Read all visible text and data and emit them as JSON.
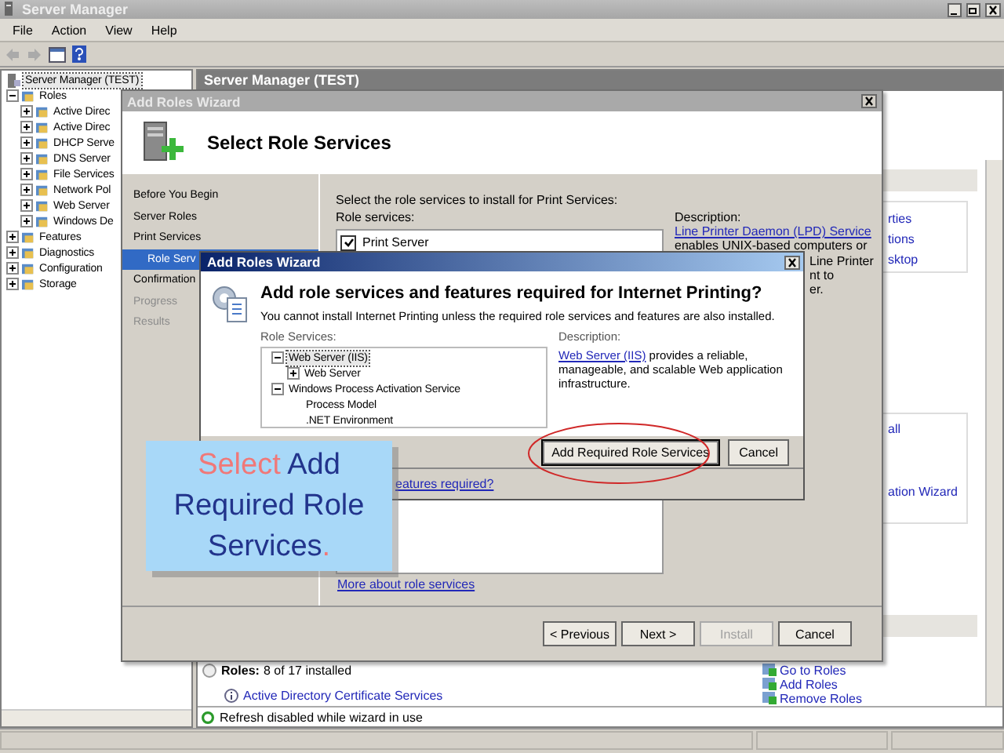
{
  "main_window": {
    "title": "Server Manager",
    "menu": [
      "File",
      "Action",
      "View",
      "Help"
    ]
  },
  "tree": {
    "root": {
      "label": "Server Manager (TEST)",
      "selected": true
    },
    "items": [
      {
        "label": "Roles",
        "expanded": true,
        "children": [
          {
            "label": "Active Direc",
            "expanded": false
          },
          {
            "label": "Active Direc",
            "expanded": false
          },
          {
            "label": "DHCP Serve",
            "expanded": false
          },
          {
            "label": "DNS Server",
            "expanded": false
          },
          {
            "label": "File Services",
            "expanded": false
          },
          {
            "label": "Network Pol",
            "expanded": false
          },
          {
            "label": "Web Server",
            "expanded": false
          },
          {
            "label": "Windows De",
            "expanded": false
          }
        ]
      },
      {
        "label": "Features",
        "expanded": false
      },
      {
        "label": "Diagnostics",
        "expanded": false
      },
      {
        "label": "Configuration",
        "expanded": false
      },
      {
        "label": "Storage",
        "expanded": false
      }
    ]
  },
  "content": {
    "header": "Server Manager (TEST)",
    "side_links_top": [
      "rties",
      "tions",
      "sktop"
    ],
    "side_links_middle": [
      "all",
      "ation Wizard"
    ],
    "roles_label": "Roles:",
    "roles_count": "8 of 17 installed",
    "role_entry": "Active Directory Certificate Services",
    "tasks": [
      "Go to Roles",
      "Add Roles",
      "Remove Roles"
    ],
    "status": "Refresh disabled while wizard in use"
  },
  "wizard": {
    "title": "Add Roles Wizard",
    "heading": "Select Role Services",
    "steps": [
      {
        "label": "Before You Begin",
        "selected": false,
        "disabled": false
      },
      {
        "label": "Server Roles",
        "selected": false,
        "disabled": false
      },
      {
        "label": "Print Services",
        "selected": false,
        "disabled": false
      },
      {
        "label": "Role Serv",
        "selected": true,
        "disabled": false
      },
      {
        "label": "Confirmation",
        "selected": false,
        "disabled": false
      },
      {
        "label": "Progress",
        "selected": false,
        "disabled": true
      },
      {
        "label": "Results",
        "selected": false,
        "disabled": true
      }
    ],
    "instruction": "Select the role services to install for Print Services:",
    "list_label": "Role services:",
    "role_services": [
      {
        "label": "Print Server",
        "checked": true
      }
    ],
    "description_label": "Description:",
    "description_link": "Line Printer Daemon (LPD) Service",
    "description_first": "enables UNIX-based computers or",
    "description_fragments": [
      "Line Printer",
      "nt to",
      "er."
    ],
    "more_link": "More about role services",
    "buttons": [
      {
        "label": "< Previous",
        "disabled": false
      },
      {
        "label": "Next >",
        "disabled": false
      },
      {
        "label": "Install",
        "disabled": true
      },
      {
        "label": "Cancel",
        "disabled": false
      }
    ]
  },
  "dialog": {
    "title": "Add Roles Wizard",
    "heading": "Add role services and features required for Internet Printing?",
    "message": "You cannot install Internet Printing unless the required role services and features are also installed.",
    "list_label": "Role Services:",
    "tree": [
      {
        "label": "Web Server (IIS)",
        "expanded": true,
        "selected": true,
        "children": [
          {
            "label": "Web Server",
            "expanded": false,
            "selected": false
          }
        ]
      },
      {
        "label": "Windows Process Activation Service",
        "expanded": true,
        "selected": false,
        "children": [
          {
            "label": "Process Model",
            "selected": false
          },
          {
            "label": ".NET Environment",
            "selected": false
          }
        ]
      }
    ],
    "description_label": "Description:",
    "description_link": "Web Server (IIS)",
    "description_text": " provides a reliable, manageable, and scalable Web application infrastructure.",
    "buttons": [
      {
        "label": "Add Required Role Services",
        "highlighted": true
      },
      {
        "label": "Cancel",
        "highlighted": false
      }
    ],
    "features_link": "eatures required?"
  },
  "callout": {
    "parts": [
      {
        "text": "Select",
        "color": "#f07878"
      },
      {
        "text": " Add Required Role Services",
        "color": "#22348c"
      },
      {
        "text": ".",
        "color": "#f07878"
      }
    ]
  }
}
